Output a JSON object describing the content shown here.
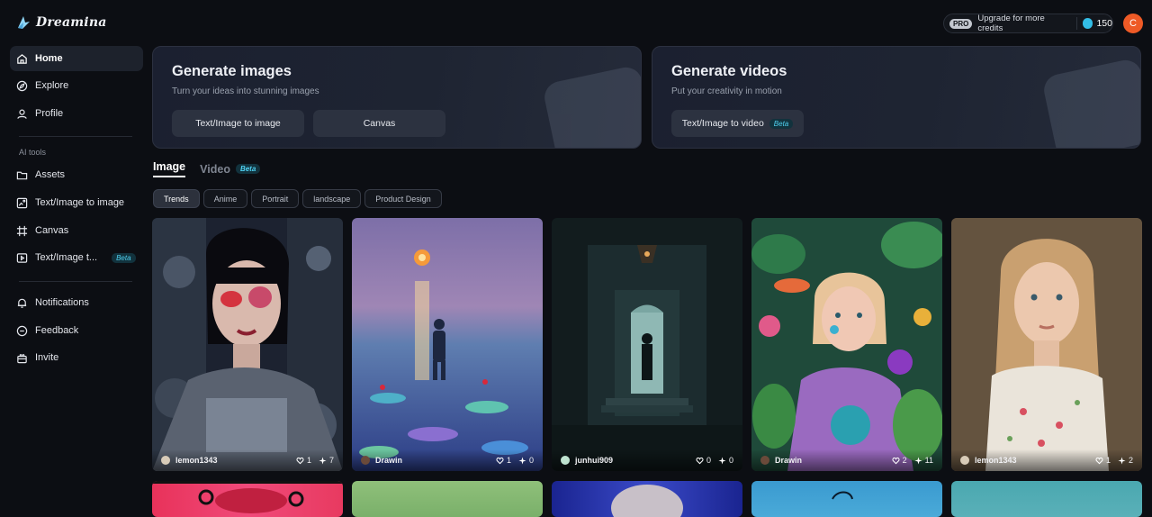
{
  "app": {
    "name": "Dreamina"
  },
  "sidebar": {
    "items": [
      {
        "label": "Home",
        "icon": "home-icon"
      },
      {
        "label": "Explore",
        "icon": "compass-icon"
      },
      {
        "label": "Profile",
        "icon": "user-icon"
      }
    ],
    "section_label": "AI tools",
    "tools": [
      {
        "label": "Assets",
        "icon": "folder-icon"
      },
      {
        "label": "Text/Image to image",
        "icon": "image-edit-icon"
      },
      {
        "label": "Canvas",
        "icon": "canvas-icon"
      },
      {
        "label": "Text/Image t...",
        "icon": "video-icon",
        "badge": "Beta"
      }
    ],
    "bottom": [
      {
        "label": "Notifications",
        "icon": "bell-icon"
      },
      {
        "label": "Feedback",
        "icon": "feedback-icon"
      },
      {
        "label": "Invite",
        "icon": "gift-icon"
      }
    ]
  },
  "topbar": {
    "pro_badge": "PRO",
    "upgrade_text": "Upgrade for more credits",
    "credits": "150",
    "avatar_letter": "C"
  },
  "cards": {
    "images": {
      "title": "Generate images",
      "subtitle": "Turn your ideas into stunning images",
      "btn1": "Text/Image to image",
      "btn2": "Canvas"
    },
    "videos": {
      "title": "Generate videos",
      "subtitle": "Put your creativity in motion",
      "btn1": "Text/Image to video",
      "btn1_badge": "Beta"
    }
  },
  "tabs": {
    "image": "Image",
    "video": "Video",
    "video_badge": "Beta"
  },
  "chips": [
    "Trends",
    "Anime",
    "Portrait",
    "landscape",
    "Product Design"
  ],
  "gallery": [
    {
      "user": "lemon1343",
      "likes": "1",
      "remixes": "7",
      "avatar_color": "#d8cbb8"
    },
    {
      "user": "Drawin",
      "likes": "1",
      "remixes": "0",
      "avatar_color": "#6a4a3a"
    },
    {
      "user": "junhui909",
      "likes": "0",
      "remixes": "0",
      "avatar_color": "#bfe3d0"
    },
    {
      "user": "Drawin",
      "likes": "2",
      "remixes": "11",
      "avatar_color": "#6a4a3a"
    },
    {
      "user": "lemon1343",
      "likes": "1",
      "remixes": "2",
      "avatar_color": "#d8cbb8"
    }
  ],
  "colors": {
    "accent": "#33bde6",
    "avatar": "#ee5a26",
    "beta_text": "#4fd0f0"
  }
}
